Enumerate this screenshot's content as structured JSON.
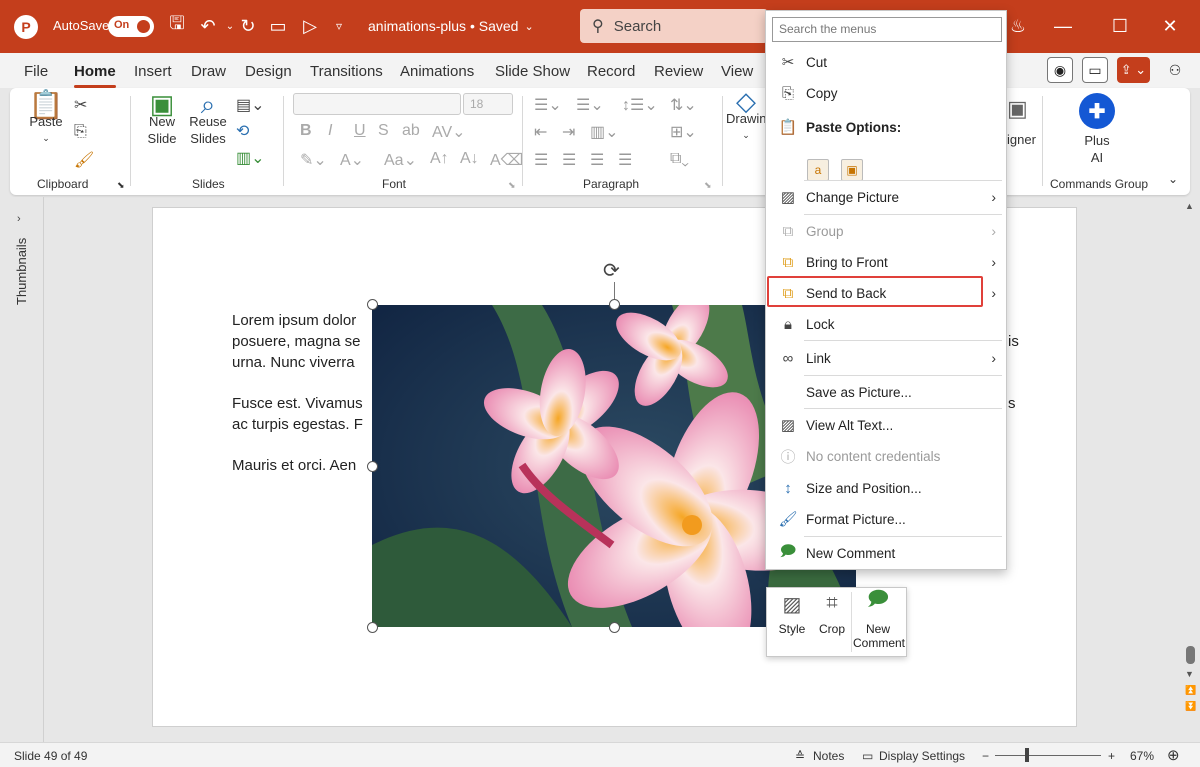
{
  "titlebar": {
    "app_logo": "P",
    "autosave_label": "AutoSave",
    "autosave_state": "On",
    "doc_title": "animations-plus • Saved",
    "search_placeholder": "Search"
  },
  "tabs": [
    "File",
    "Home",
    "Insert",
    "Draw",
    "Design",
    "Transitions",
    "Animations",
    "Slide Show",
    "Record",
    "Review",
    "View"
  ],
  "active_tab": "Home",
  "ribbon": {
    "clipboard": {
      "paste": "Paste",
      "label": "Clipboard"
    },
    "slides": {
      "new_slide_1": "New",
      "new_slide_2": "Slide",
      "reuse_1": "Reuse",
      "reuse_2": "Slides",
      "label": "Slides"
    },
    "font": {
      "size": "18",
      "label": "Font"
    },
    "paragraph": {
      "label": "Paragraph"
    },
    "drawing": {
      "label": "Drawin"
    },
    "designer": {
      "label": "igner"
    },
    "commands": {
      "plus": "Plus",
      "ai": "AI",
      "label": "Commands Group"
    }
  },
  "thumbnails_label": "Thumbnails",
  "slide": {
    "para1_line1": "Lorem ipsum dolor",
    "para1_line2": "posuere, magna se",
    "para1_line3": "urna. Nunc viverra",
    "para1_right": "is",
    "para2_line1": "Fusce est. Vivamus",
    "para2_line2": "ac turpis egestas. F",
    "para2_right": "s",
    "para3_line1": "Mauris et orci. Aen"
  },
  "context_menu": {
    "search_placeholder": "Search the menus",
    "items": {
      "cut": "Cut",
      "copy": "Copy",
      "paste_options": "Paste Options:",
      "change_picture": "Change Picture",
      "group": "Group",
      "bring_to_front": "Bring to Front",
      "send_to_back": "Send to Back",
      "lock": "Lock",
      "link": "Link",
      "save_as_picture": "Save as Picture...",
      "view_alt_text": "View Alt Text...",
      "no_content_credentials": "No content credentials",
      "size_and_position": "Size and Position...",
      "format_picture": "Format Picture...",
      "new_comment": "New Comment"
    }
  },
  "mini_toolbar": {
    "style": "Style",
    "crop": "Crop",
    "new_comment_1": "New",
    "new_comment_2": "Comment"
  },
  "statusbar": {
    "slide_info": "Slide 49 of 49",
    "notes": "Notes",
    "display_settings": "Display Settings",
    "zoom_minus": "−",
    "zoom_plus": "+",
    "zoom": "67%",
    "zoom_level": 0.3
  },
  "colors": {
    "accent": "#c43e1c",
    "highlight": "#e0403a",
    "ai_blue": "#1458d4"
  }
}
